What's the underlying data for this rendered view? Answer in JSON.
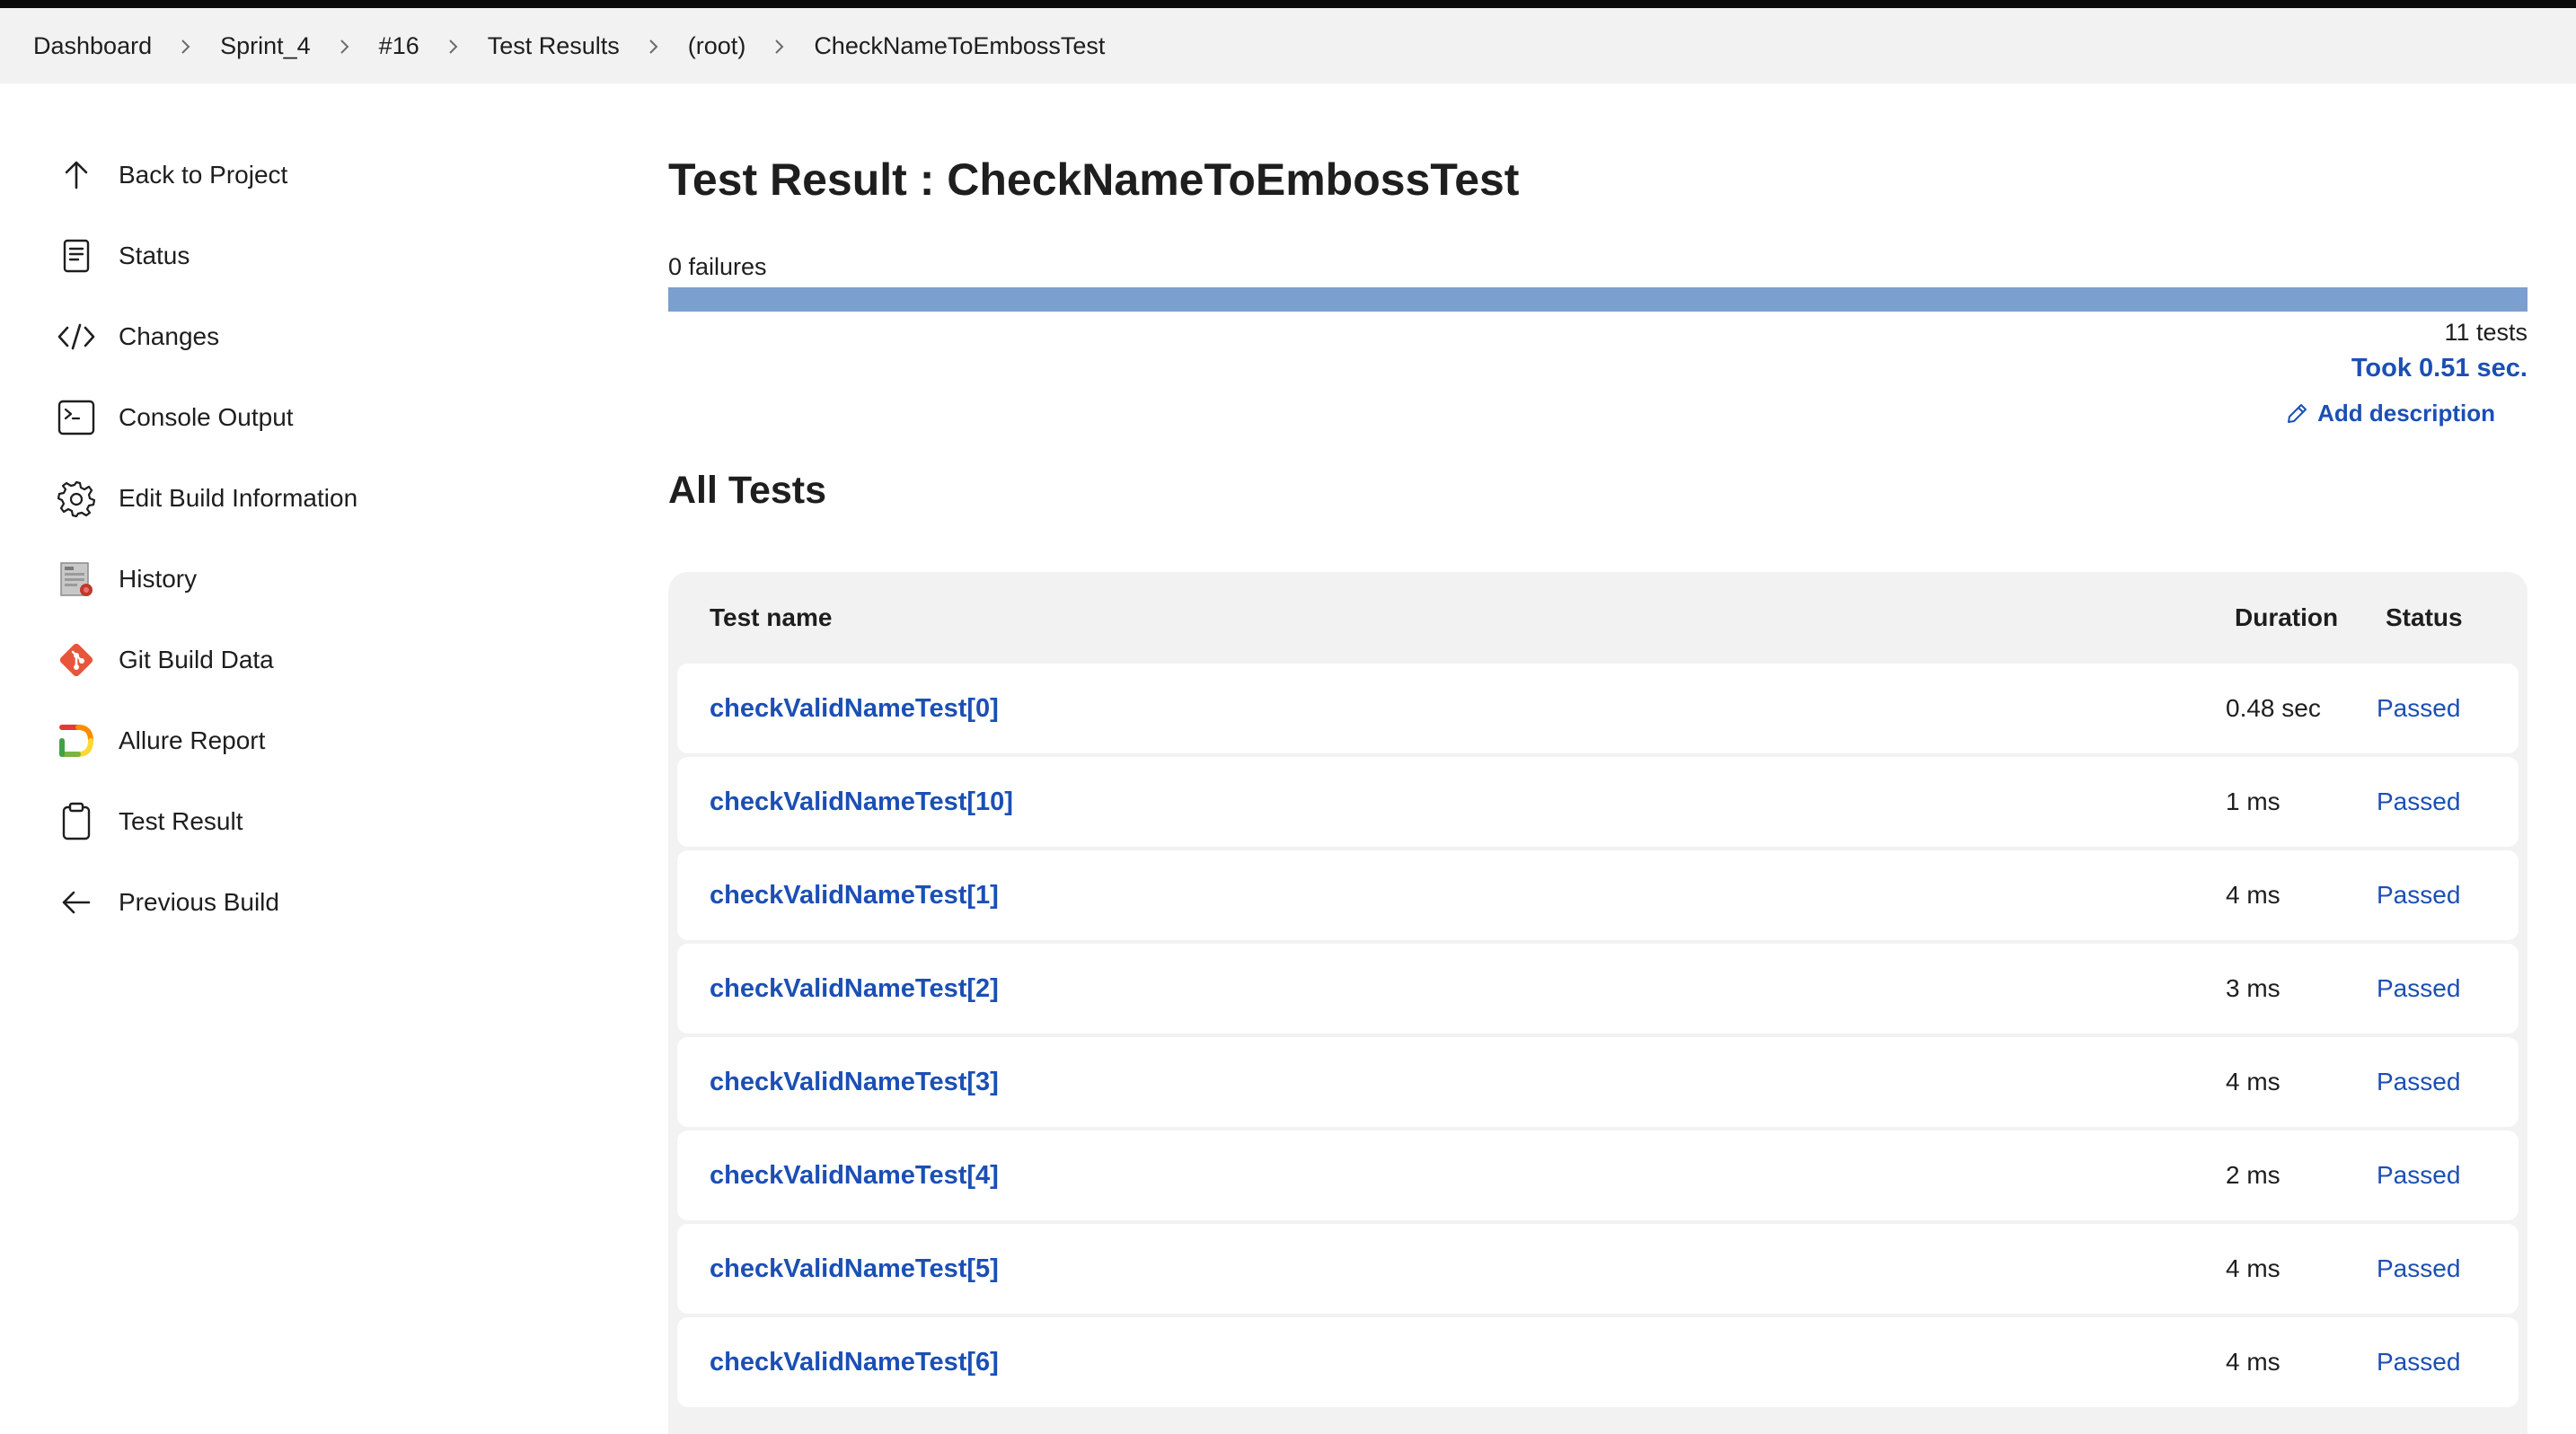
{
  "breadcrumb": [
    "Dashboard",
    "Sprint_4",
    "#16",
    "Test Results",
    "(root)",
    "CheckNameToEmbossTest"
  ],
  "sidebar": {
    "items": [
      {
        "label": "Back to Project",
        "icon": "arrow-up-icon"
      },
      {
        "label": "Status",
        "icon": "document-icon"
      },
      {
        "label": "Changes",
        "icon": "code-icon"
      },
      {
        "label": "Console Output",
        "icon": "terminal-icon"
      },
      {
        "label": "Edit Build Information",
        "icon": "gear-icon"
      },
      {
        "label": "History",
        "icon": "history-icon"
      },
      {
        "label": "Git Build Data",
        "icon": "git-icon"
      },
      {
        "label": "Allure Report",
        "icon": "allure-icon"
      },
      {
        "label": "Test Result",
        "icon": "clipboard-icon"
      },
      {
        "label": "Previous Build",
        "icon": "arrow-left-icon"
      }
    ]
  },
  "main": {
    "title": "Test Result : CheckNameToEmbossTest",
    "failures": "0 failures",
    "progress_fraction": 1.0,
    "tests_count": "11 tests",
    "took": "Took 0.51 sec.",
    "add_description": "Add description",
    "section_title": "All Tests"
  },
  "table": {
    "headers": {
      "name": "Test name",
      "duration": "Duration",
      "status": "Status"
    },
    "rows": [
      {
        "name": "checkValidNameTest[0]",
        "duration": "0.48 sec",
        "status": "Passed"
      },
      {
        "name": "checkValidNameTest[10]",
        "duration": "1 ms",
        "status": "Passed"
      },
      {
        "name": "checkValidNameTest[1]",
        "duration": "4 ms",
        "status": "Passed"
      },
      {
        "name": "checkValidNameTest[2]",
        "duration": "3 ms",
        "status": "Passed"
      },
      {
        "name": "checkValidNameTest[3]",
        "duration": "4 ms",
        "status": "Passed"
      },
      {
        "name": "checkValidNameTest[4]",
        "duration": "2 ms",
        "status": "Passed"
      },
      {
        "name": "checkValidNameTest[5]",
        "duration": "4 ms",
        "status": "Passed"
      },
      {
        "name": "checkValidNameTest[6]",
        "duration": "4 ms",
        "status": "Passed"
      }
    ]
  },
  "colors": {
    "link": "#1b4fb4",
    "progress": "#7b9fce",
    "header_bg": "#f2f2f2"
  }
}
